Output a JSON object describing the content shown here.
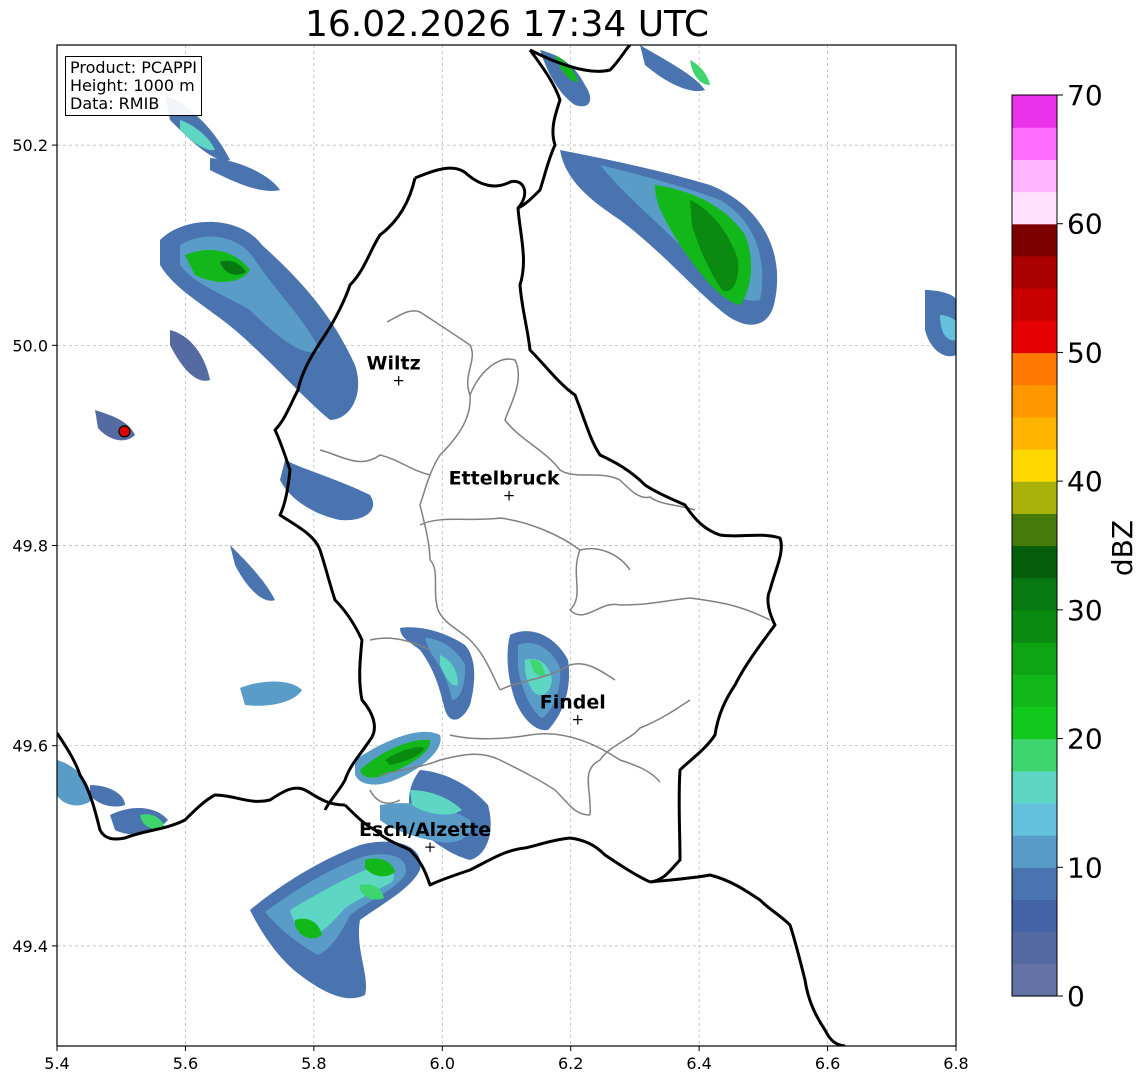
{
  "title": "16.02.2026 17:34 UTC",
  "info": {
    "product": "Product: PCAPPI",
    "height": "Height: 1000 m",
    "data": "Data: RMIB"
  },
  "map": {
    "lon_range": [
      5.4,
      6.8
    ],
    "lat_range": [
      49.3,
      50.3
    ],
    "x_ticks": [
      "5.4",
      "5.6",
      "5.8",
      "6.0",
      "6.2",
      "6.4",
      "6.6",
      "6.8"
    ],
    "y_ticks": [
      "49.4",
      "49.6",
      "49.8",
      "50.0",
      "50.2"
    ],
    "grid": true,
    "places": [
      {
        "name": "Wiltz",
        "lon": 5.932,
        "lat": 49.966
      },
      {
        "name": "Ettelbruck",
        "lon": 6.104,
        "lat": 49.851
      },
      {
        "name": "Findel",
        "lon": 6.211,
        "lat": 49.627
      },
      {
        "name": "Esch/Alzette",
        "lon": 5.981,
        "lat": 49.5
      }
    ],
    "radar_site": {
      "lon": 5.505,
      "lat": 49.914,
      "color": "#e00000"
    }
  },
  "colorbar": {
    "label": "dBZ",
    "ticks": [
      "0",
      "10",
      "20",
      "30",
      "40",
      "50",
      "60",
      "70"
    ],
    "range": [
      0,
      70
    ],
    "colors": [
      "#6473a6",
      "#546aa0",
      "#4462a6",
      "#4a74b0",
      "#5a9cc8",
      "#64c0dc",
      "#5ed6c4",
      "#3ed46e",
      "#12c81c",
      "#12b81a",
      "#0fa414",
      "#0a8a10",
      "#087812",
      "#055e0a",
      "#467a0a",
      "#aab20a",
      "#ffd800",
      "#ffb400",
      "#ff9800",
      "#ff7a00",
      "#e40000",
      "#c80000",
      "#aa0000",
      "#7c0000",
      "#ffe0ff",
      "#ffb6ff",
      "#ff6eff",
      "#ea32ea"
    ]
  }
}
